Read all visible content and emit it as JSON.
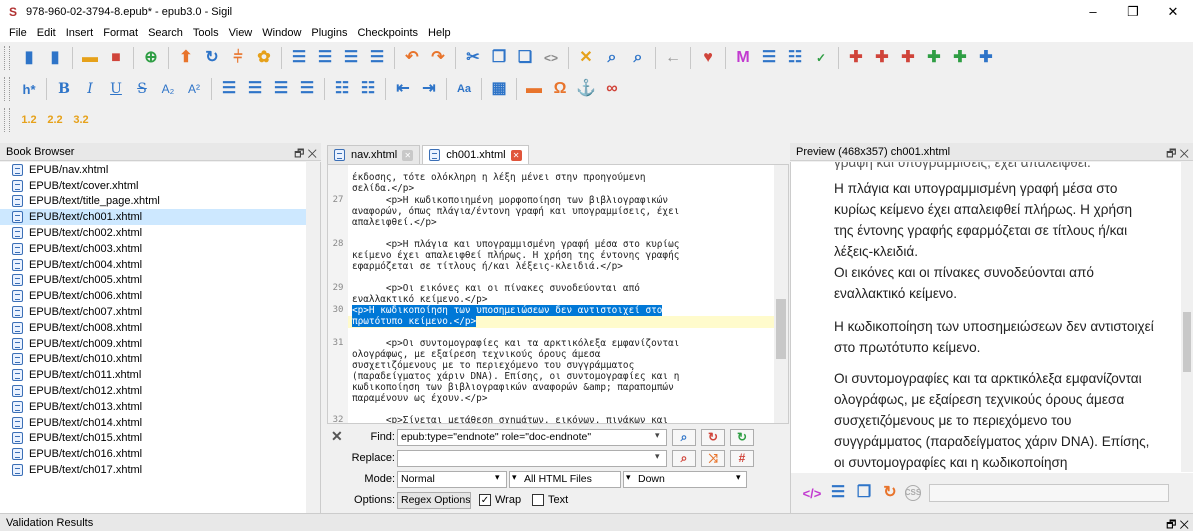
{
  "window": {
    "title": "978-960-02-3794-8.epub* - epub3.0 - Sigil",
    "icon": "sigil-logo",
    "controls": [
      "–",
      "❐",
      "✕"
    ]
  },
  "menu": [
    "File",
    "Edit",
    "Insert",
    "Format",
    "Search",
    "Tools",
    "View",
    "Window",
    "Plugins",
    "Checkpoints",
    "Help"
  ],
  "toolbar2": {
    "heading": "h*",
    "bold": "B",
    "italic": "I",
    "underline": "U",
    "strike": "S",
    "sub": "A₂",
    "sup": "A²",
    "case": "Aa"
  },
  "toolbar3": {
    "h1": "1.2",
    "h2": "2.2",
    "h3": "3.2"
  },
  "book_browser": {
    "title": "Book Browser",
    "items": [
      "EPUB/nav.xhtml",
      "EPUB/text/cover.xhtml",
      "EPUB/text/title_page.xhtml",
      "EPUB/text/ch001.xhtml",
      "EPUB/text/ch002.xhtml",
      "EPUB/text/ch003.xhtml",
      "EPUB/text/ch004.xhtml",
      "EPUB/text/ch005.xhtml",
      "EPUB/text/ch006.xhtml",
      "EPUB/text/ch007.xhtml",
      "EPUB/text/ch008.xhtml",
      "EPUB/text/ch009.xhtml",
      "EPUB/text/ch010.xhtml",
      "EPUB/text/ch011.xhtml",
      "EPUB/text/ch012.xhtml",
      "EPUB/text/ch013.xhtml",
      "EPUB/text/ch014.xhtml",
      "EPUB/text/ch015.xhtml",
      "EPUB/text/ch016.xhtml",
      "EPUB/text/ch017.xhtml"
    ],
    "selected_index": 3
  },
  "tabs": [
    {
      "label": "nav.xhtml"
    },
    {
      "label": "ch001.xhtml"
    }
  ],
  "editor": {
    "line_numbers": [
      "27",
      "28",
      "29",
      "30",
      "31",
      "32"
    ],
    "lines": [
      "έκδοσης, τότε ολόκληρη η λέξη μένει στην προηγούμενη",
      "σελίδα.</p>",
      "      <p>Η κωδικοποιημένη μορφοποίηση των βιβλιογραφικών",
      "αναφορών, όπως πλάγια/έντονη γραφή και υπογραμμίσεις, έχει",
      "απαλειφθεί.</p>",
      "      <p>Η πλάγια και υπογραμμισμένη γραφή μέσα στο κυρίως",
      "κείμενο έχει απαλειφθεί πλήρως. Η χρήση της έντονης γραφής",
      "εφαρμόζεται σε τίτλους ή/και λέξεις-κλειδιά.</p>",
      "      <p>Οι εικόνες και οι πίνακες συνοδεύονται από",
      "εναλλακτικό κείμενο.</p>",
      "<p>Η κωδικοποίηση των υποσημειώσεων δεν αντιστοιχεί στο",
      "πρωτότυπο κείμενο.</p>",
      "      <p>Οι συντομογραφίες και τα αρκτικόλεξα εμφανίζονται",
      "ολογράφως, με εξαίρεση τεχνικούς όρους άμεσα",
      "συσχετιζόμενους με το περιεχόμενο του συγγράμματος",
      "(παραδείγματος χάριν DNA). Επίσης, οι συντομογραφίες και η",
      "κωδικοποίηση των βιβλιογραφικών αναφορών &amp; παραπομπών",
      "παραμένουν ως έχουν.</p>",
      "      <p>Σίνεται μετάθεση σχημάτων, εικόνων, πινάκων και"
    ]
  },
  "find": {
    "find_label": "Find:",
    "find_value": "epub:type=\"endnote\" role=\"doc-endnote\"",
    "replace_label": "Replace:",
    "replace_value": "",
    "mode_label": "Mode:",
    "mode_value": "Normal",
    "scope_value": "All HTML Files",
    "direction_value": "Down",
    "options_label": "Options:",
    "regex_label": "Regex Options",
    "wrap_label": "Wrap",
    "text_label": "Text",
    "wrap_checked": true,
    "text_checked": false
  },
  "preview": {
    "title": "Preview (468x357) ch001.xhtml",
    "cut_top": "γραφή και υπογραμμίσεις, έχει απαλειφθεί.",
    "paragraphs": [
      "Η πλάγια και υπογραμμισμένη γραφή μέσα στο κυρίως κείμενο έχει απαλειφθεί πλήρως. Η χρήση της έντονης γραφής εφαρμόζεται σε τίτλους ή/και λέξεις-κλειδιά.",
      "Οι εικόνες και οι πίνακες συνοδεύονται από εναλλακτικό κείμενο.",
      "Η κωδικοποίηση των υποσημειώσεων δεν αντιστοιχεί στο πρωτότυπο κείμενο.",
      "Οι συντομογραφίες και τα αρκτικόλεξα εμφανίζονται ολογράφως, με εξαίρεση τεχνικούς όρους άμεσα συσχετιζόμενους με το περιεχόμενο του συγγράμματος (παραδείγματος χάριν DNA). Επίσης, οι συντομογραφίες και η κωδικοποίηση"
    ],
    "css_label": "CSS"
  },
  "status": {
    "title": "Validation Results"
  },
  "colors": {
    "accent": "#0078d7",
    "tab_close": "#e0553b",
    "highlight": "#0078d7",
    "current_line": "#fffbcc"
  }
}
